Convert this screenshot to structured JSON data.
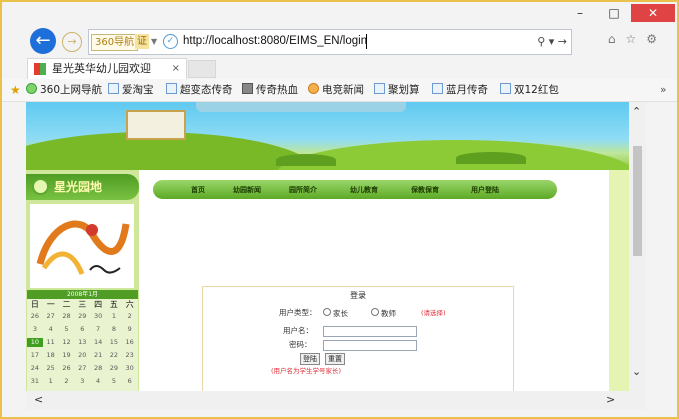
{
  "browser": {
    "window_controls": {
      "minimize": "–",
      "maximize": "□",
      "close": "✕"
    },
    "address": {
      "nav_badge": "360导航",
      "cert_badge": "证",
      "url": "http://localhost:8080/EIMS_EN/login",
      "search_symbol": "⚲ ▾",
      "go_symbol": "→"
    },
    "toolbar_icons": [
      "home-icon",
      "star-icon",
      "gear-icon"
    ],
    "tab": {
      "title": "星光英华幼儿园欢迎",
      "close": "×"
    },
    "favorites": [
      {
        "label": "360上网导航",
        "icon": "360-icon"
      },
      {
        "label": "爱淘宝",
        "icon": "page-icon"
      },
      {
        "label": "超变态传奇",
        "icon": "page-icon"
      },
      {
        "label": "传奇热血",
        "icon": "game-icon"
      },
      {
        "label": "电竞新闻",
        "icon": "globe-icon"
      },
      {
        "label": "聚划算",
        "icon": "page-icon"
      },
      {
        "label": "蓝月传奇",
        "icon": "page-icon"
      },
      {
        "label": "双12红包",
        "icon": "page-icon"
      }
    ],
    "overflow": "»"
  },
  "page": {
    "sidebar_title": "星光园地",
    "calendar": {
      "title": "2008年1月",
      "weekdays": [
        "日",
        "一",
        "二",
        "三",
        "四",
        "五",
        "六"
      ],
      "rows": [
        [
          "26",
          "27",
          "28",
          "29",
          "30",
          "1",
          "2"
        ],
        [
          "3",
          "4",
          "5",
          "6",
          "7",
          "8",
          "9"
        ],
        [
          "10",
          "11",
          "12",
          "13",
          "14",
          "15",
          "16"
        ],
        [
          "17",
          "18",
          "19",
          "20",
          "21",
          "22",
          "23"
        ],
        [
          "24",
          "25",
          "26",
          "27",
          "28",
          "29",
          "30"
        ],
        [
          "31",
          "1",
          "2",
          "3",
          "4",
          "5",
          "6"
        ]
      ]
    },
    "menu": [
      "首页",
      "幼园新闻",
      "园所简介",
      "幼儿教育",
      "保教保育",
      "用户登陆"
    ],
    "login": {
      "title": "登录",
      "user_type_label": "用户类型：",
      "option_parent": "家长",
      "option_teacher": "教师",
      "hint": "(请选择)",
      "username_label": "用户名：",
      "password_label": "密码：",
      "login_button": "登陆",
      "reset_button": "重置",
      "note": "(用户名为学生学号家长)"
    }
  },
  "colors": {
    "accent_blue": "#1e6fd9",
    "close_red": "#e04343",
    "menu_green": "#5da926",
    "sidebar_bg": "#cfe79a"
  }
}
